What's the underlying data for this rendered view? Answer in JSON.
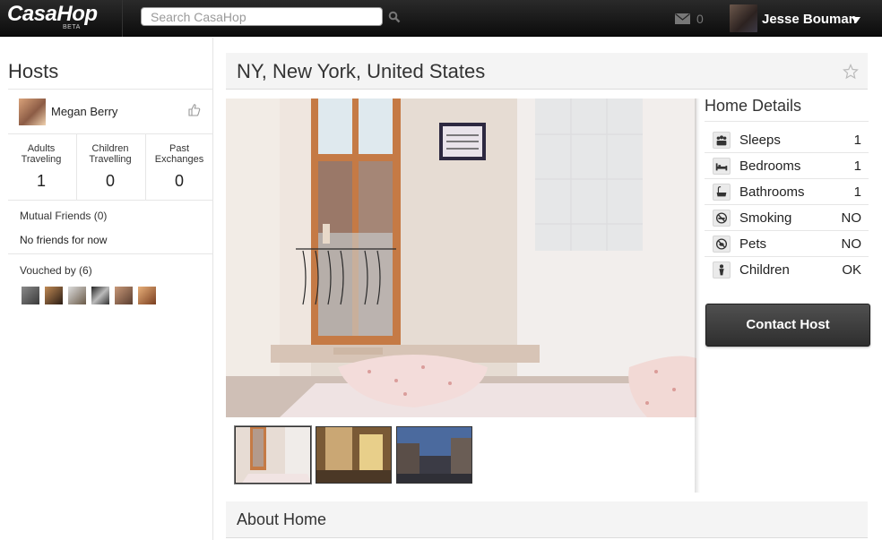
{
  "topbar": {
    "logo": "CasaHop",
    "beta": "BETA",
    "search_placeholder": "Search CasaHop",
    "mail_count": "0",
    "user_name": "Jesse Bouman"
  },
  "hosts": {
    "title": "Hosts",
    "host_name": "Megan Berry",
    "stats": [
      {
        "label": "Adults Traveling",
        "value": "1"
      },
      {
        "label": "Children Travelling",
        "value": "0"
      },
      {
        "label": "Past Exchanges",
        "value": "0"
      }
    ],
    "mutual_friends_label": "Mutual Friends (0)",
    "mutual_friends_text": "No friends for now",
    "vouched_label": "Vouched by (6)"
  },
  "listing": {
    "location": "NY, New York, United States",
    "details_title": "Home Details",
    "details": [
      {
        "icon": "people-icon",
        "label": "Sleeps",
        "value": "1"
      },
      {
        "icon": "bed-icon",
        "label": "Bedrooms",
        "value": "1"
      },
      {
        "icon": "bathtub-icon",
        "label": "Bathrooms",
        "value": "1"
      },
      {
        "icon": "no-smoking-icon",
        "label": "Smoking",
        "value": "NO"
      },
      {
        "icon": "no-pets-icon",
        "label": "Pets",
        "value": "NO"
      },
      {
        "icon": "child-icon",
        "label": "Children",
        "value": "OK"
      }
    ],
    "contact_button": "Contact Host",
    "about_title": "About Home"
  }
}
